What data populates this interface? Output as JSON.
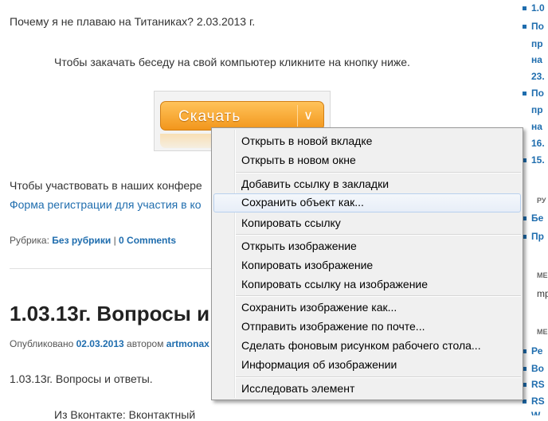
{
  "post1": {
    "title_line": "Почему я не плаваю на Титаниках? 2.03.2013 г.",
    "download_instruction": "Чтобы закачать беседу на свой компьютер кликните на кнопку ниже.",
    "download_button": "Скачать",
    "participate_text": "Чтобы участвовать в наших конфере",
    "registration_link": "Форма регистрации для участия в ко",
    "category_label": "Рубрика:",
    "category_value": "Без рубрики",
    "separator": "|",
    "comments": "0 Comments"
  },
  "post2": {
    "title": "1.03.13г. Вопросы и",
    "published_label": "Опубликовано",
    "date": "02.03.2013",
    "author_label": "автором",
    "author": "artmonax",
    "body_line": "1.03.13г. Вопросы и ответы.",
    "next_line": "Из Вконтакте: Вконтактный"
  },
  "sidebar": {
    "items": [
      {
        "text": "1.0"
      },
      {
        "text": "По"
      },
      {
        "text": "пр"
      },
      {
        "text": "на"
      },
      {
        "text": "23."
      },
      {
        "text": "По"
      },
      {
        "text": "пр"
      },
      {
        "text": "на"
      },
      {
        "text": "16."
      },
      {
        "text": "15."
      }
    ],
    "heading1": "РУ",
    "links1": [
      {
        "text": "Бе"
      },
      {
        "text": "Пр"
      }
    ],
    "heading2": "МЕ",
    "meta1": "mp",
    "heading3": "МЕ",
    "links2": [
      {
        "text": "Ре"
      },
      {
        "text": "Во"
      },
      {
        "text": "RS"
      },
      {
        "text": "RS"
      },
      {
        "text": "W"
      }
    ]
  },
  "context_menu": {
    "items": [
      {
        "label": "Открыть в новой вкладке"
      },
      {
        "label": "Открыть в новом окне"
      },
      {
        "label": "Добавить ссылку в закладки"
      },
      {
        "label": "Сохранить объект как..."
      },
      {
        "label": "Копировать ссылку"
      },
      {
        "label": "Открыть изображение"
      },
      {
        "label": "Копировать изображение"
      },
      {
        "label": "Копировать ссылку на изображение"
      },
      {
        "label": "Сохранить изображение как..."
      },
      {
        "label": "Отправить изображение по почте..."
      },
      {
        "label": "Сделать фоновым рисунком рабочего стола..."
      },
      {
        "label": "Информация об изображении"
      },
      {
        "label": "Исследовать элемент"
      }
    ],
    "highlighted_item": "Сохранить объект как..."
  },
  "colors": {
    "link": "#1f6dae",
    "button": "#f2961c",
    "menu_bg": "#f0f0f0",
    "highlight": "#e7eef8"
  }
}
